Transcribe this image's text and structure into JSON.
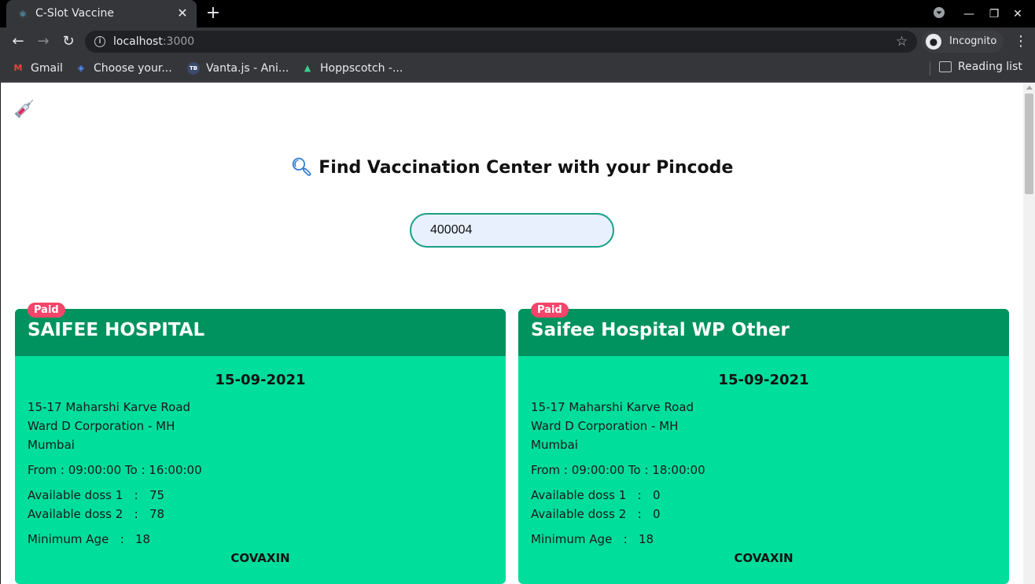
{
  "browser": {
    "tab_title": "C-Slot Vaccine",
    "url_host": "localhost",
    "url_port": ":3000",
    "profile_label": "Incognito",
    "bookmarks": [
      "Gmail",
      "Choose your...",
      "Vanta.js - Ani...",
      "Hoppscotch -..."
    ],
    "reading_list": "Reading list"
  },
  "page": {
    "heading": "Find Vaccination Center with your Pincode",
    "pincode_value": "400004",
    "centers": [
      {
        "badge": "Paid",
        "name": "SAIFEE HOSPITAL",
        "date": "15-09-2021",
        "address": "15-17 Maharshi Karve Road",
        "block": "Ward D Corporation - MH",
        "district": "Mumbai",
        "timing": "From : 09:00:00 To : 16:00:00",
        "dose1": "Available doss 1   :   75",
        "dose2": "Available doss 2   :   78",
        "min_age": "Minimum Age   :   18",
        "vaccine": "COVAXIN"
      },
      {
        "badge": "Paid",
        "name": "Saifee Hospital WP Other",
        "date": "15-09-2021",
        "address": "15-17 Maharshi Karve Road",
        "block": "Ward D Corporation - MH",
        "district": "Mumbai",
        "timing": "From : 09:00:00 To : 18:00:00",
        "dose1": "Available doss 1   :   0",
        "dose2": "Available doss 2   :   0",
        "min_age": "Minimum Age   :   18",
        "vaccine": "COVAXIN"
      }
    ]
  },
  "colors": {
    "card_bg": "#00de9c",
    "card_header": "#00935f",
    "badge": "#f5456a",
    "input_border": "#17a085"
  }
}
